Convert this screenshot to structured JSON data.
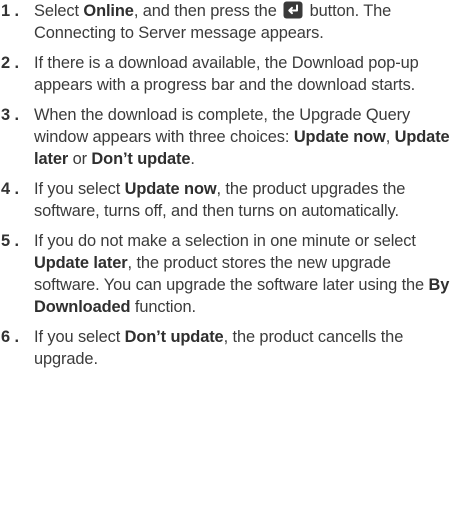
{
  "steps": [
    {
      "number": "1 .",
      "parts": [
        {
          "t": "Select "
        },
        {
          "b": "Online"
        },
        {
          "t": ", and then press the "
        },
        {
          "icon": "enter-button-icon"
        },
        {
          "t": " button. The Connecting to Server message appears."
        }
      ]
    },
    {
      "number": "2 .",
      "parts": [
        {
          "t": "If there is a download available, the Download pop-up appears with a progress bar and the download starts."
        }
      ]
    },
    {
      "number": "3 .",
      "parts": [
        {
          "t": "When the download is complete, the Upgrade Query window appears with three choices: "
        },
        {
          "b": "Update now"
        },
        {
          "t": ", "
        },
        {
          "b": "Update later"
        },
        {
          "t": " or "
        },
        {
          "b": "Don’t update"
        },
        {
          "t": "."
        }
      ]
    },
    {
      "number": "4 .",
      "parts": [
        {
          "t": "If you select "
        },
        {
          "b": "Update now"
        },
        {
          "t": ", the product upgrades the software, turns off, and then turns on automatically."
        }
      ]
    },
    {
      "number": "5 .",
      "parts": [
        {
          "t": "If you do not make a selection in one minute or select "
        },
        {
          "b": "Update later"
        },
        {
          "t": ", the product stores the new upgrade software. You can upgrade the software later using the "
        },
        {
          "b": "By Downloaded"
        },
        {
          "t": " function."
        }
      ]
    },
    {
      "number": "6 .",
      "parts": [
        {
          "t": "If you select "
        },
        {
          "b": "Don’t update"
        },
        {
          "t": ", the product cancells the upgrade."
        }
      ]
    }
  ]
}
